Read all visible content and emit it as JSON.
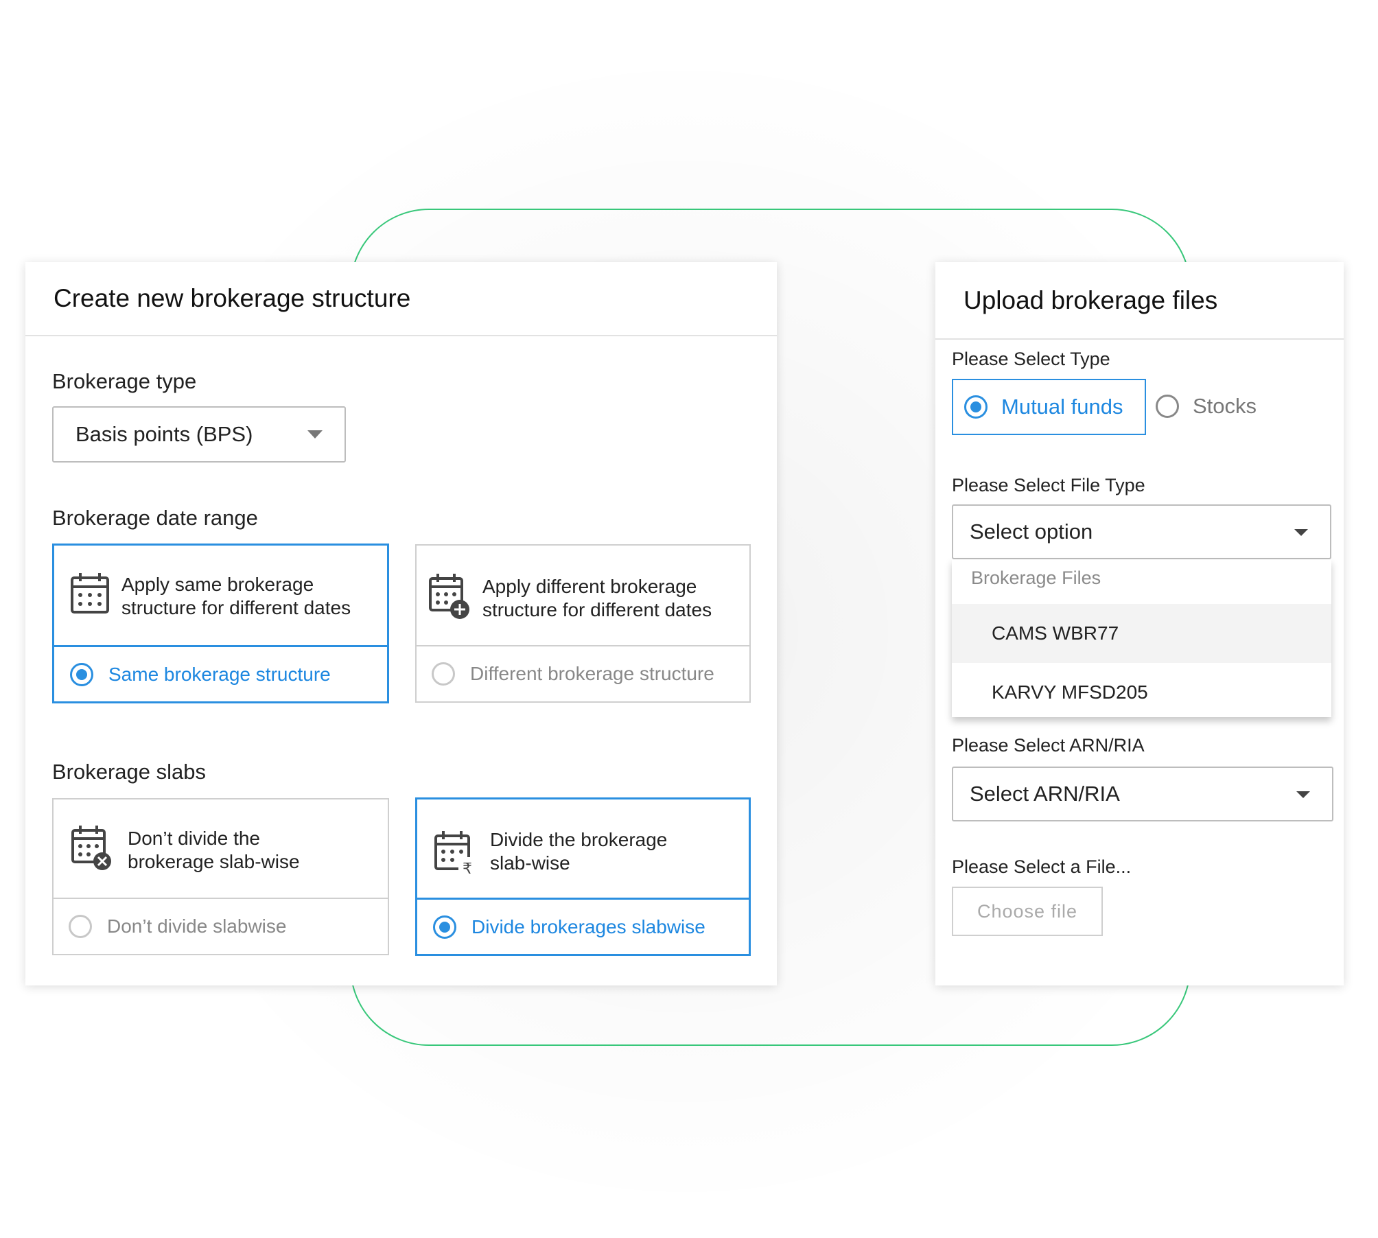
{
  "left": {
    "title": "Create new brokerage structure",
    "brokerage_type": {
      "label": "Brokerage type",
      "value": "Basis points (BPS)"
    },
    "date_range": {
      "label": "Brokerage date range",
      "options": [
        {
          "text_line1": "Apply same brokerage",
          "text_line2": "structure for different dates",
          "radio_label": "Same brokerage structure",
          "selected": true
        },
        {
          "text_line1": "Apply different brokerage",
          "text_line2": "structure for different dates",
          "radio_label": "Different brokerage structure",
          "selected": false
        }
      ]
    },
    "slabs": {
      "label": "Brokerage slabs",
      "options": [
        {
          "text_line1": "Don’t divide the",
          "text_line2": "brokerage slab-wise",
          "radio_label": "Don’t divide slabwise",
          "selected": false
        },
        {
          "text_line1": "Divide the brokerage",
          "text_line2": "slab-wise",
          "radio_label": "Divide brokerages slabwise",
          "selected": true
        }
      ]
    }
  },
  "right": {
    "title": "Upload brokerage files",
    "select_type": {
      "label": "Please Select Type",
      "options": [
        "Mutual funds",
        "Stocks"
      ],
      "selected": "Mutual funds"
    },
    "file_type": {
      "label": "Please Select File Type",
      "value": "Select option",
      "dropdown": {
        "group": "Brokerage Files",
        "items": [
          "CAMS WBR77",
          "KARVY MFSD205"
        ],
        "highlighted": "CAMS WBR77"
      }
    },
    "arn": {
      "label": "Please Select ARN/RIA",
      "value": "Select ARN/RIA"
    },
    "file": {
      "label": "Please Select a File...",
      "button": "Choose file"
    }
  },
  "colors": {
    "accent": "#2a8fe0",
    "frame": "#38c77a"
  }
}
